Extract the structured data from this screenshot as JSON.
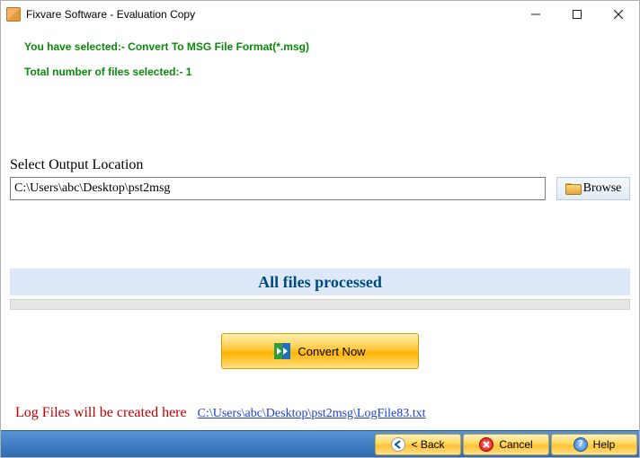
{
  "window": {
    "title": "Fixvare Software - Evaluation Copy"
  },
  "info": {
    "selected_format": "You have selected:- Convert To MSG File Format(*.msg)",
    "file_count": "Total number of files selected:- 1"
  },
  "output": {
    "label": "Select Output Location",
    "path": "C:\\Users\\abc\\Desktop\\pst2msg",
    "browse_label": "Browse"
  },
  "status": {
    "text": "All files processed"
  },
  "convert": {
    "label": "Convert Now"
  },
  "log": {
    "label": "Log Files will be created here",
    "link": "C:\\Users\\abc\\Desktop\\pst2msg\\LogFile83.txt"
  },
  "buttons": {
    "back": "< Back",
    "cancel": "Cancel",
    "help": "Help"
  }
}
